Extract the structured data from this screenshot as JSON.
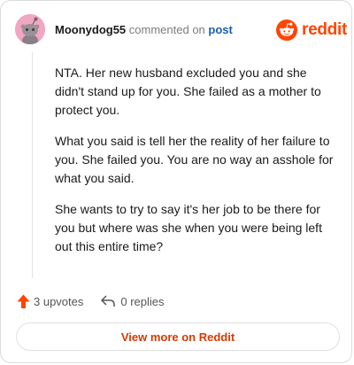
{
  "header": {
    "username": "Moonydog55",
    "action_text": "commented on",
    "post_link": "post"
  },
  "brand": {
    "icon": "reddit-alien-icon",
    "wordmark": "reddit",
    "color": "#ff4500"
  },
  "comment": {
    "paragraphs": [
      "NTA. Her new husband excluded you and she didn't stand up for you. She failed as a mother to protect you.",
      "What you said is tell her the reality of her failure to you. She failed you. You are no way an asshole for what you said.",
      "She wants to try to say it's her job to be there for you but where was she when you were being left out this entire time?"
    ]
  },
  "actions": {
    "upvotes_label": "3 upvotes",
    "replies_label": "0 replies",
    "upvote_icon": "upvote-arrow-icon",
    "reply_icon": "reply-arrow-icon"
  },
  "footer": {
    "view_more_label": "View more on Reddit"
  },
  "colors": {
    "accent": "#ff4500",
    "link": "#1a5fb4",
    "avatar_bg": "#f1a6c1",
    "button_text": "#d93900"
  }
}
